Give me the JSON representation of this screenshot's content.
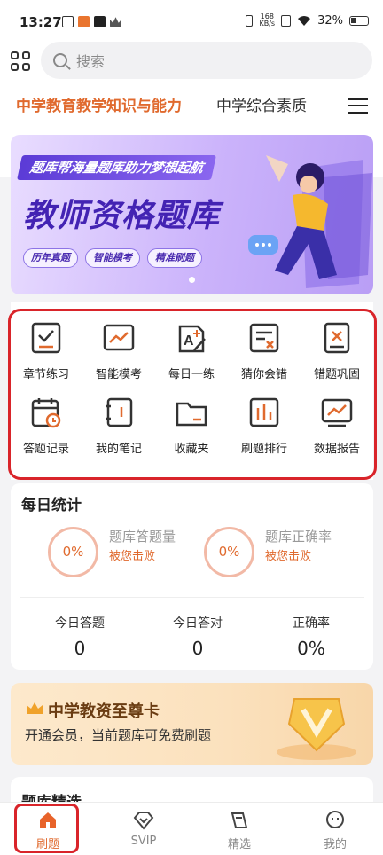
{
  "status_bar": {
    "time": "13:27",
    "speed_value": "168",
    "speed_unit": "KB/s",
    "battery": "32%"
  },
  "search": {
    "placeholder": "搜索"
  },
  "tabs": [
    {
      "label": "中学教育教学知识与能力",
      "active": true
    },
    {
      "label": "中学综合素质",
      "active": false
    }
  ],
  "banner": {
    "slogan": "题库帮海量题库助力梦想起航",
    "title": "教师资格题库",
    "tags": [
      "历年真题",
      "智能模考",
      "精准刷题"
    ]
  },
  "functions": [
    {
      "label": "章节练习",
      "icon": "checklist-icon"
    },
    {
      "label": "智能模考",
      "icon": "trend-chart-icon"
    },
    {
      "label": "每日一练",
      "icon": "a-plus-pen-icon"
    },
    {
      "label": "猜你会错",
      "icon": "doc-x-icon"
    },
    {
      "label": "错题巩固",
      "icon": "wrong-doc-icon"
    },
    {
      "label": "答题记录",
      "icon": "calendar-clock-icon"
    },
    {
      "label": "我的笔记",
      "icon": "notebook-icon"
    },
    {
      "label": "收藏夹",
      "icon": "folder-icon"
    },
    {
      "label": "刷题排行",
      "icon": "bar-rank-icon"
    },
    {
      "label": "数据报告",
      "icon": "report-chart-icon"
    }
  ],
  "daily_stats": {
    "title": "每日统计",
    "ring1": {
      "value": "0%",
      "label": "题库答题量",
      "sub": "被您击败"
    },
    "ring2": {
      "value": "0%",
      "label": "题库正确率",
      "sub": "被您击败"
    },
    "metrics": [
      {
        "label": "今日答题",
        "value": "0"
      },
      {
        "label": "今日答对",
        "value": "0"
      },
      {
        "label": "正确率",
        "value": "0%"
      }
    ]
  },
  "vip": {
    "title": "中学教资至尊卡",
    "subtitle": "开通会员，当前题库可免费刷题"
  },
  "section_pick": {
    "title": "题库精选"
  },
  "nav": [
    {
      "label": "刷题",
      "icon": "home-icon",
      "active": true
    },
    {
      "label": "SVIP",
      "icon": "diamond-icon",
      "active": false
    },
    {
      "label": "精选",
      "icon": "book-icon",
      "active": false
    },
    {
      "label": "我的",
      "icon": "chat-bubble-icon",
      "active": false
    }
  ],
  "colors": {
    "accent": "#e06a2e",
    "highlight_outline": "#d9242a",
    "banner_title": "#4323b3"
  }
}
